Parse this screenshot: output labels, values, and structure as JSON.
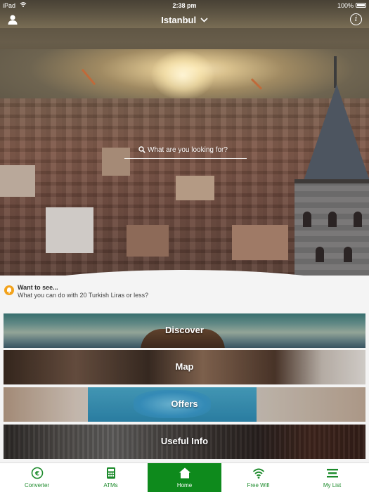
{
  "status_bar": {
    "device": "iPad",
    "time": "2:38 pm",
    "battery": "100%"
  },
  "header": {
    "city": "Istanbul",
    "info_symbol": "i"
  },
  "search": {
    "placeholder": "What are you looking for?"
  },
  "banner": {
    "title": "Want to see...",
    "subtitle": "What you can do with 20 Turkish Liras or less?"
  },
  "cards": [
    {
      "label": "Discover"
    },
    {
      "label": "Map"
    },
    {
      "label": "Offers"
    },
    {
      "label": "Useful Info"
    }
  ],
  "tabs": [
    {
      "label": "Converter",
      "icon": "euro-coin-icon"
    },
    {
      "label": "ATMs",
      "icon": "calculator-icon"
    },
    {
      "label": "Home",
      "icon": "home-icon",
      "active": true
    },
    {
      "label": "Free Wifi",
      "icon": "wifi-icon"
    },
    {
      "label": "My List",
      "icon": "list-icon"
    }
  ],
  "colors": {
    "brand_green": "#0e8a1c",
    "banner_icon": "#f2a21b"
  }
}
